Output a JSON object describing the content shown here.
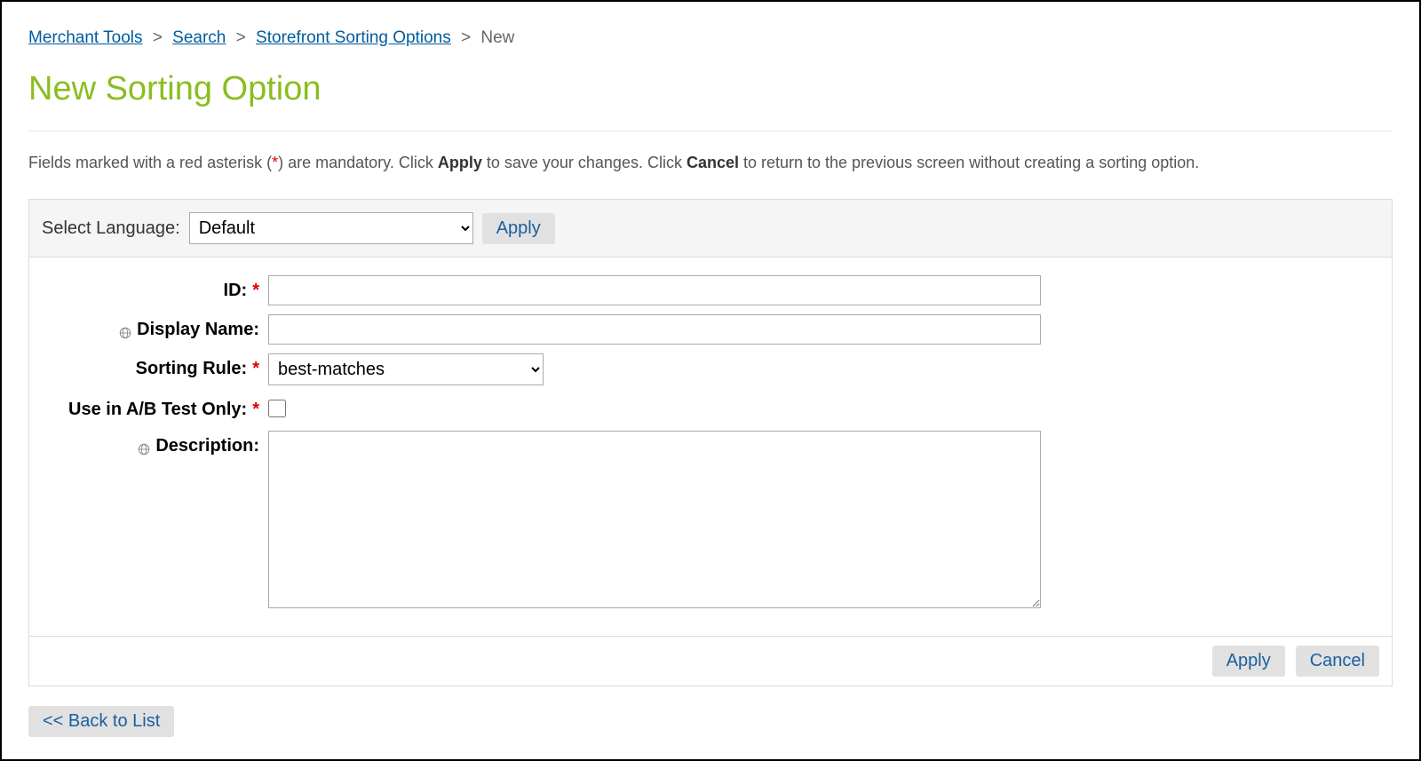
{
  "breadcrumb": {
    "items": [
      {
        "label": "Merchant Tools",
        "link": true
      },
      {
        "label": "Search",
        "link": true
      },
      {
        "label": "Storefront Sorting Options",
        "link": true
      },
      {
        "label": "New",
        "link": false
      }
    ]
  },
  "page": {
    "title": "New Sorting Option"
  },
  "help": {
    "prefix": "Fields marked with a red asterisk (",
    "asterisk": "*",
    "mid1": ") are mandatory. Click ",
    "apply_word": "Apply",
    "mid2": " to save your changes. Click ",
    "cancel_word": "Cancel",
    "suffix": " to return to the previous screen without creating a sorting option."
  },
  "language_bar": {
    "label": "Select Language:",
    "selected": "Default",
    "apply_label": "Apply"
  },
  "fields": {
    "id": {
      "label": "ID:",
      "value": ""
    },
    "display_name": {
      "label": "Display Name:",
      "value": ""
    },
    "sorting_rule": {
      "label": "Sorting Rule:",
      "selected": "best-matches"
    },
    "ab_test": {
      "label": "Use in A/B Test Only:",
      "checked": false
    },
    "description": {
      "label": "Description:",
      "value": ""
    }
  },
  "actions": {
    "apply": "Apply",
    "cancel": "Cancel",
    "back": "<< Back to List"
  }
}
